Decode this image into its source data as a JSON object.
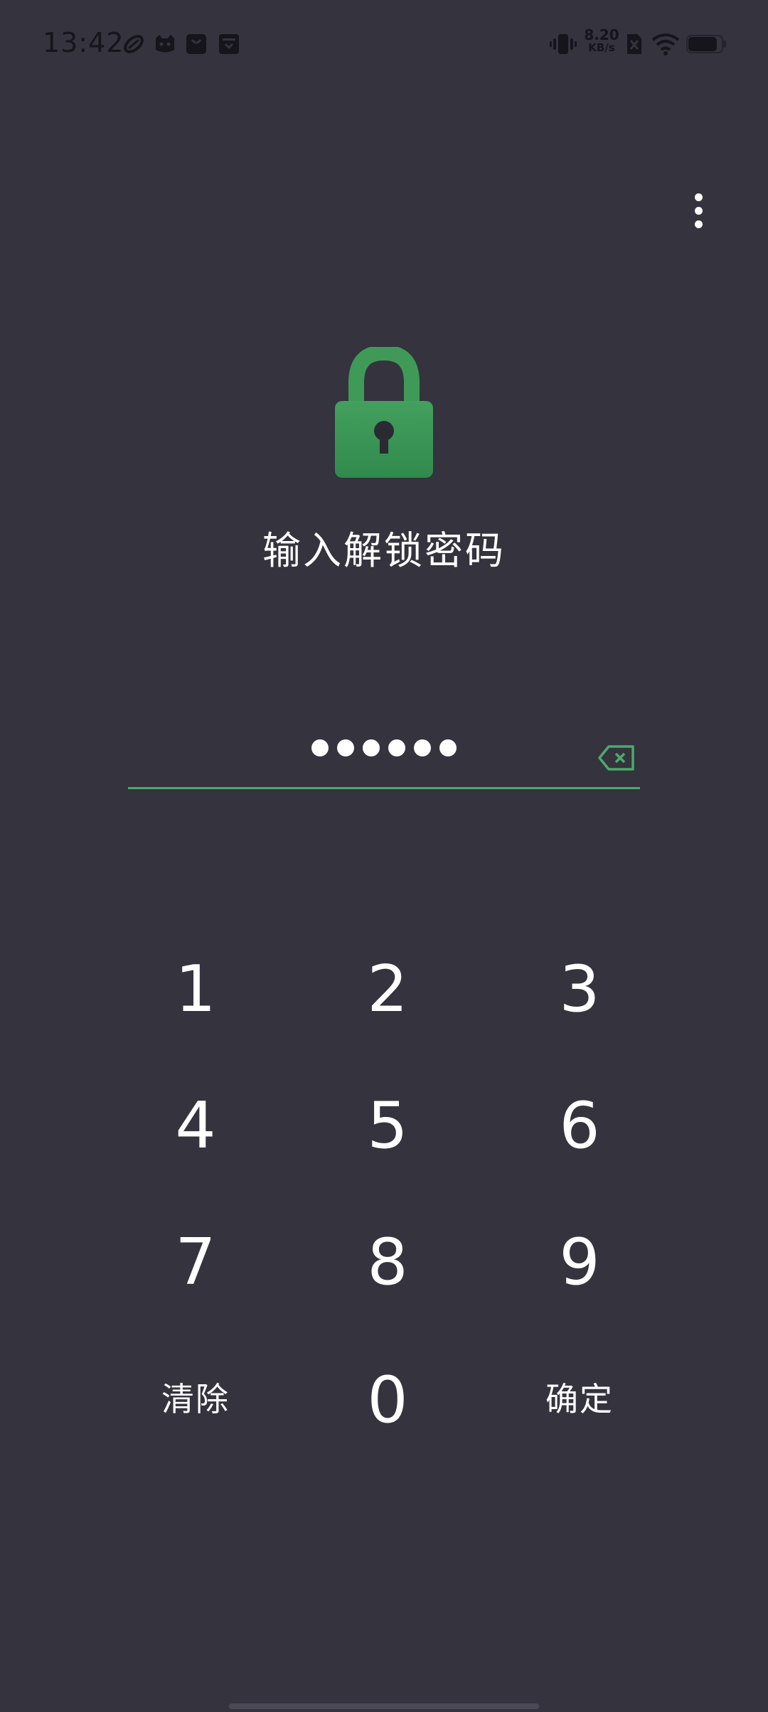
{
  "status_bar": {
    "time": "13:42",
    "net_speed_value": "8.20",
    "net_speed_unit": "KB/s",
    "notification_icons": [
      "rugby-ball-icon",
      "cat-face-icon",
      "shopping-bag-icon",
      "archive-box-icon"
    ],
    "system_icons": [
      "vibrate-icon",
      "sim-disabled-icon",
      "wifi-icon",
      "battery-icon"
    ]
  },
  "lock_screen": {
    "title": "输入解锁密码",
    "entered_length": 6,
    "more_icon": "more-vertical-icon",
    "lock_icon": "padlock-icon",
    "backspace_icon": "backspace-icon"
  },
  "keypad": {
    "rows": [
      [
        "1",
        "2",
        "3"
      ],
      [
        "4",
        "5",
        "6"
      ],
      [
        "7",
        "8",
        "9"
      ]
    ],
    "zero": "0",
    "clear_label": "清除",
    "confirm_label": "确定"
  },
  "colors": {
    "background": "#34333e",
    "accent": "#4caa6b",
    "text": "#ffffff",
    "status_text": "#15151b"
  }
}
